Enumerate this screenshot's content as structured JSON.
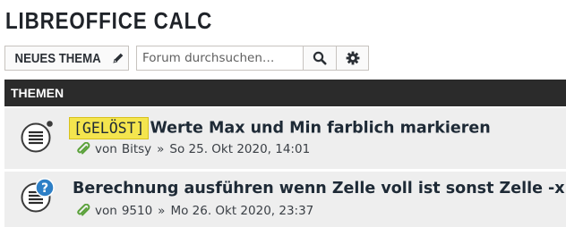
{
  "forum": {
    "title": "LIBREOFFICE CALC"
  },
  "toolbar": {
    "new_topic_label": "NEUES THEMA",
    "search_placeholder": "Forum durchsuchen…"
  },
  "topics_header": "THEMEN",
  "topics": [
    {
      "tag": "[GELÖST]",
      "title": "Werte Max und Min farblich markieren",
      "by": "von",
      "author": "Bitsy",
      "separator": "»",
      "date": "So 25. Okt 2020, 14:01",
      "status_icon": "read-topic-icon-with-dot",
      "attachment_icon": "paperclip-icon"
    },
    {
      "tag": "",
      "title": "Berechnung ausführen wenn Zelle voll ist sonst Zelle -x",
      "by": "von",
      "author": "9510",
      "separator": "»",
      "date": "Mo 26. Okt 2020, 23:37",
      "status_icon": "question-topic-icon",
      "attachment_icon": "paperclip-icon"
    }
  ],
  "colors": {
    "header_bg": "#2b2b2b",
    "row_bg": "#eeeeee",
    "solved_tag_bg": "#f4e54e",
    "question_badge": "#2d7fc6",
    "paperclip": "#5aa13a"
  }
}
